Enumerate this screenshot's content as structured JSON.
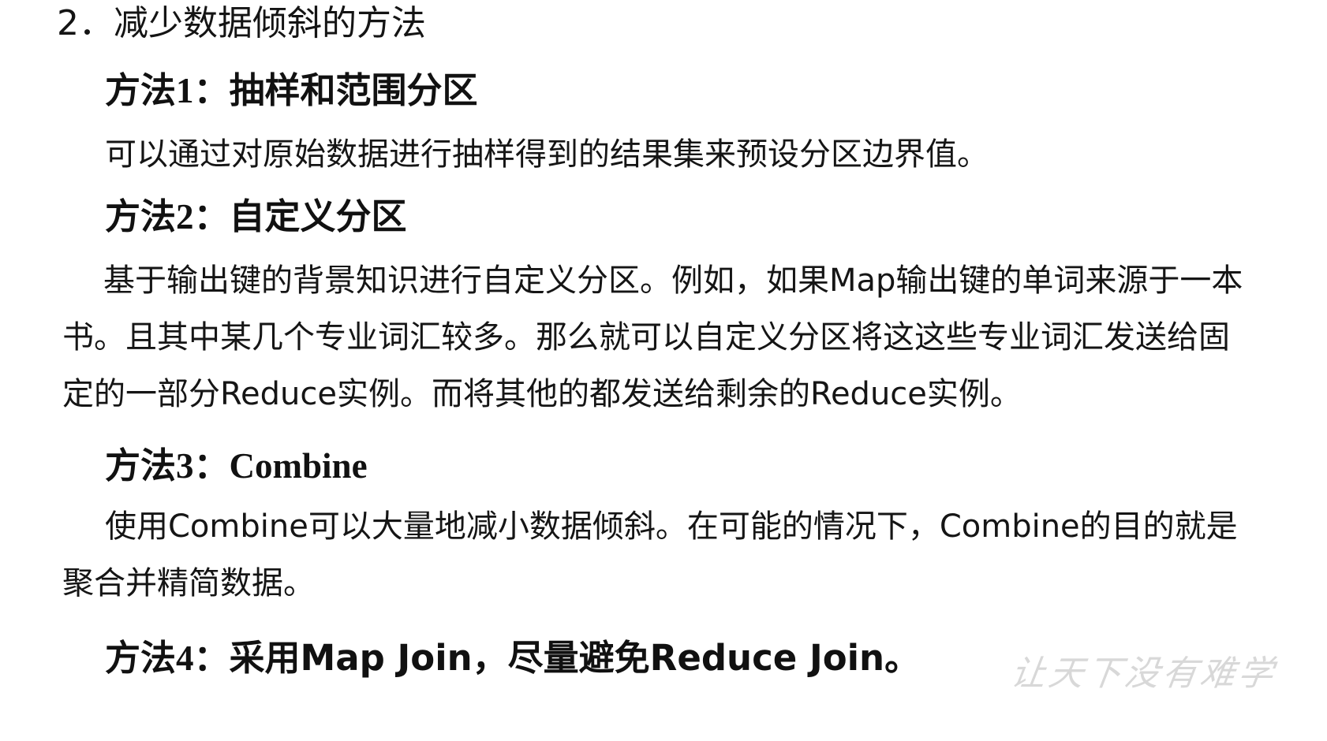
{
  "section": {
    "title": "2．减少数据倾斜的方法"
  },
  "methods": [
    {
      "title_prefix": "方法",
      "title_num": "1",
      "title_sep": "：",
      "title_body": "抽样和范围分区",
      "lines": [
        "可以通过对原始数据进行抽样得到的结果集来预设分区边界值。"
      ]
    },
    {
      "title_prefix": "方法",
      "title_num": "2",
      "title_sep": "：",
      "title_body": "自定义分区",
      "lines": [
        "基于输出键的背景知识进行自定义分区。例如，如果Map输出键的单词来源于一本",
        "书。且其中某几个专业词汇较多。那么就可以自定义分区将这这些专业词汇发送给固",
        "定的一部分Reduce实例。而将其他的都发送给剩余的Reduce实例。"
      ]
    },
    {
      "title_prefix": "方法",
      "title_num": "3",
      "title_sep": "：",
      "title_body": "Combine",
      "lines": [
        "使用Combine可以大量地减小数据倾斜。在可能的情况下，Combine的目的就是",
        "聚合并精简数据。"
      ]
    },
    {
      "title_prefix": "方法",
      "title_num": "4",
      "title_sep": "：",
      "title_body": "采用Map Join，尽量避免Reduce Join。",
      "lines": []
    }
  ],
  "watermark": {
    "text": "让天下没有难学"
  }
}
